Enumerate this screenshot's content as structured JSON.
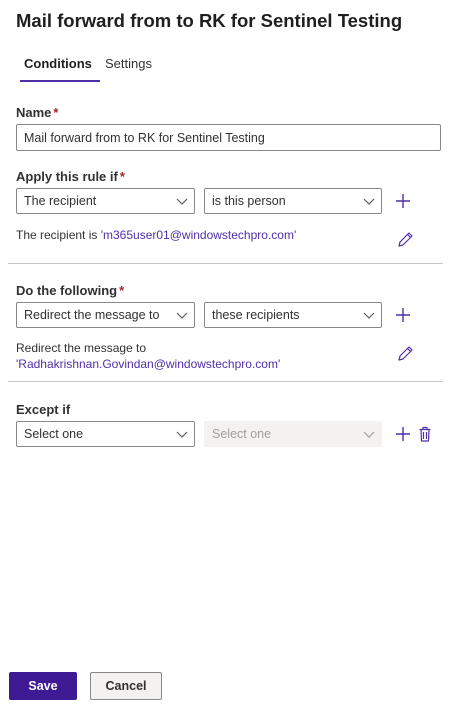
{
  "header": {
    "title": "Mail forward from to RK for Sentinel Testing"
  },
  "tabs": [
    {
      "label": "Conditions",
      "active": true
    },
    {
      "label": "Settings",
      "active": false
    }
  ],
  "name_field": {
    "label": "Name",
    "required_mark": "*",
    "value": "Mail forward from to RK for Sentinel Testing"
  },
  "apply_rule": {
    "label": "Apply this rule if",
    "required_mark": "*",
    "condition_select": "The recipient",
    "operator_select": "is this person",
    "summary_prefix": "The recipient is",
    "summary_value": "'m365user01@windowstechpro.com'"
  },
  "do_following": {
    "label": "Do the following",
    "required_mark": "*",
    "action_select": "Redirect the message to",
    "target_select": "these recipients",
    "summary_prefix": "Redirect the message to",
    "summary_value": "'Radhakrishnan.Govindan@windowstechpro.com'"
  },
  "except_if": {
    "label": "Except if",
    "condition_select": "Select one",
    "operator_select": "Select one"
  },
  "footer": {
    "save_label": "Save",
    "cancel_label": "Cancel"
  },
  "colors": {
    "accent": "#4f2fa8",
    "primary_button": "#3e1a94",
    "required": "#a4262c"
  },
  "icons": [
    "chevron-down-icon",
    "add-icon",
    "edit-icon",
    "delete-icon"
  ]
}
